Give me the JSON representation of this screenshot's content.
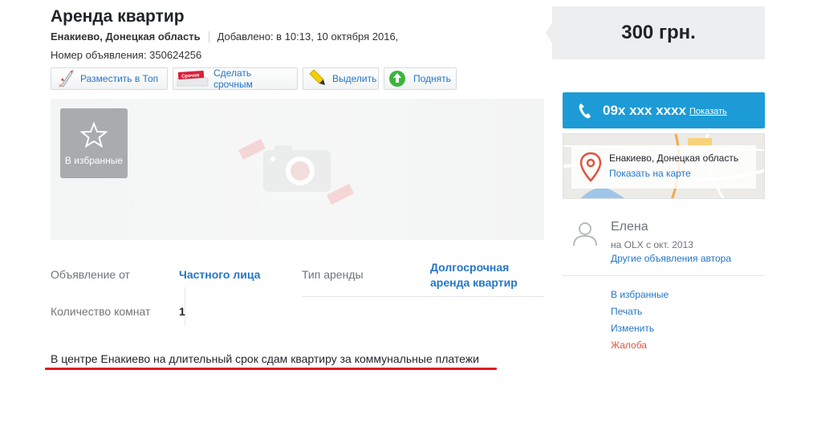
{
  "ad": {
    "title": "Аренда квартир",
    "location": "Енакиево, Донецкая область",
    "added": "Добавлено: в 10:13, 10 октября 2016,",
    "number": "Номер объявления: 350624256"
  },
  "actions": {
    "top": "Разместить в Топ",
    "urgent": "Сделать срочным",
    "urgent_badge": "Срочно",
    "highlight": "Выделить",
    "raise": "Поднять"
  },
  "gallery": {
    "favorite_label": "В избранные"
  },
  "params": {
    "from_label": "Объявление от",
    "from_value": "Частного лица",
    "rent_label": "Тип аренды",
    "rent_value_line1": "Долгосрочная",
    "rent_value_line2": "аренда квартир",
    "rooms_label": "Количество комнат",
    "rooms_value": "1"
  },
  "description": "В центре Енакиево на длительный срок сдам квартиру за коммунальные платежи",
  "sidebar": {
    "price": "300 грн.",
    "phone": "09x xxx xxxx",
    "phone_show": "Показать",
    "map_location": "Енакиево, Донецкая область",
    "map_link": "Показать на карте",
    "user_name": "Елена",
    "user_since": "на OLX с окт. 2013",
    "user_other": "Другие объявления автора",
    "links": {
      "favorite": "В избранные",
      "print": "Печать",
      "edit": "Изменить",
      "report": "Жалоба"
    }
  },
  "colors": {
    "link": "#2476c6",
    "phone_button": "#1d9bd7",
    "underline": "#e11b22",
    "report": "#e2533d"
  }
}
